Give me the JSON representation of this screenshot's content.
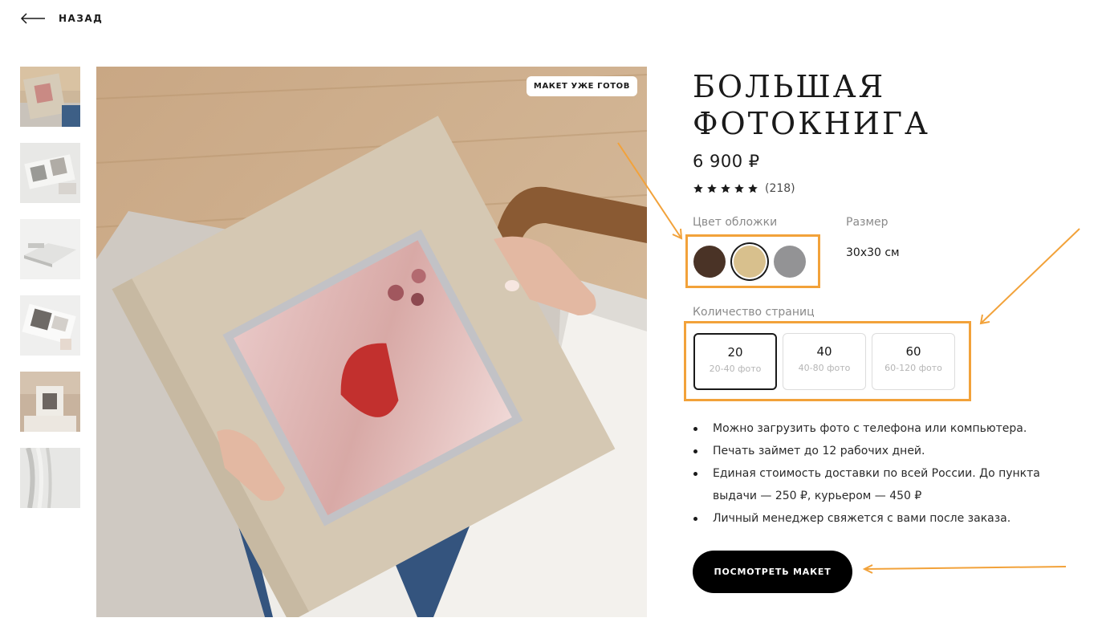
{
  "nav": {
    "back_label": "НАЗАД"
  },
  "badge": {
    "label": "МАКЕТ УЖЕ ГОТОВ"
  },
  "product": {
    "title": "БОЛЬШАЯ ФОТОКНИГА",
    "price": "6 900 ₽",
    "rating_stars": 5,
    "rating_count": "(218)"
  },
  "options": {
    "cover_color_label": "Цвет обложки",
    "colors": [
      {
        "name": "dark-brown",
        "hex": "#4a3326",
        "selected": false
      },
      {
        "name": "beige",
        "hex": "#d8c08d",
        "selected": true
      },
      {
        "name": "grey",
        "hex": "#939395",
        "selected": false
      }
    ],
    "size_label": "Размер",
    "size_value": "30х30 см",
    "pages_label": "Количество страниц",
    "pages": [
      {
        "count": "20",
        "photos": "20-40 фото",
        "selected": true
      },
      {
        "count": "40",
        "photos": "40-80 фото",
        "selected": false
      },
      {
        "count": "60",
        "photos": "60-120 фото",
        "selected": false
      }
    ]
  },
  "bullets": [
    "Можно загрузить фото с телефона или компьютера.",
    "Печать займет до 12 рабочих дней.",
    "Единая стоимость доставки по всей России. До пункта выдачи — 250 ₽, курьером — 450 ₽",
    "Личный менеджер свяжется с вами после заказа."
  ],
  "cta": {
    "label": "ПОСМОТРЕТЬ МАКЕТ"
  },
  "colors": {
    "accent_annotation": "#f2a23a",
    "cta_bg": "#000000"
  }
}
